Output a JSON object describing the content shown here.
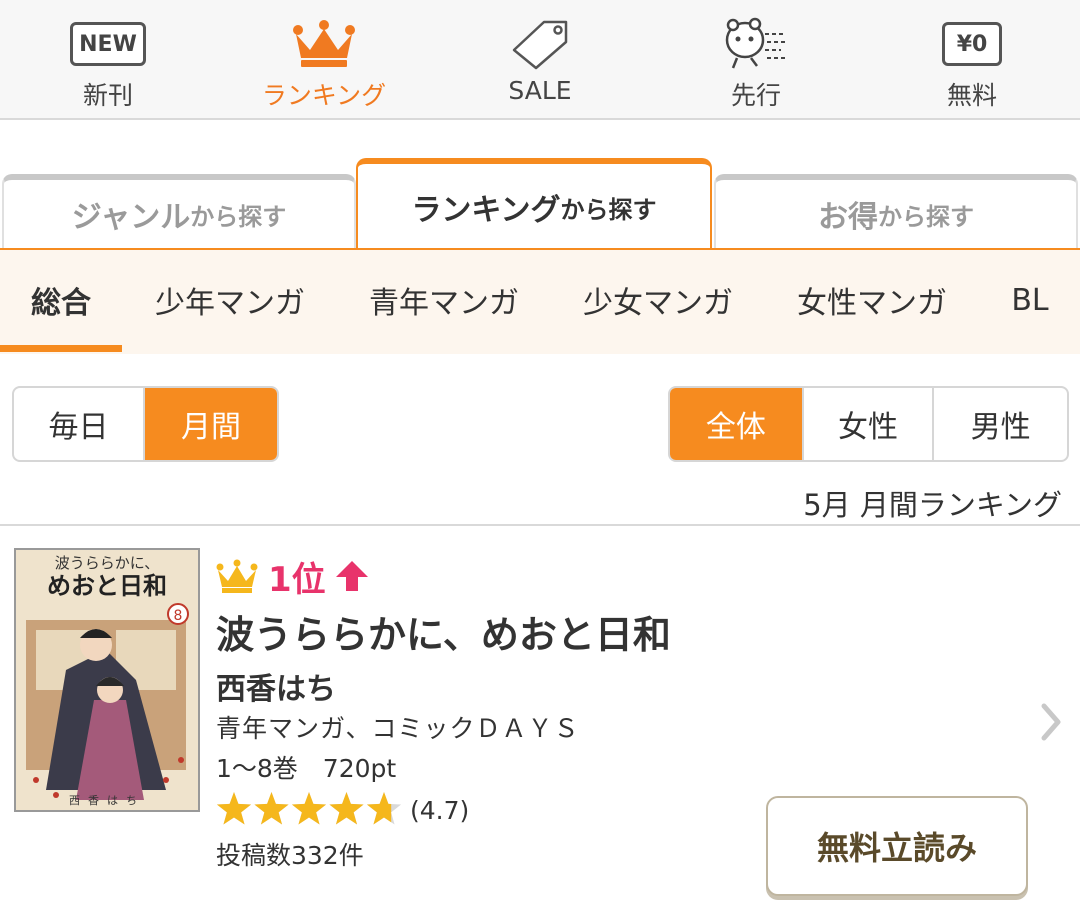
{
  "top_nav": {
    "items": [
      {
        "label": "新刊",
        "icon": "new-badge-icon",
        "badge": "NEW",
        "active": false
      },
      {
        "label": "ランキング",
        "icon": "crown-icon",
        "active": true
      },
      {
        "label": "SALE",
        "icon": "price-tag-icon",
        "active": false
      },
      {
        "label": "先行",
        "icon": "running-mascot-icon",
        "active": false
      },
      {
        "label": "無料",
        "icon": "yen-zero-badge-icon",
        "badge": "¥0",
        "active": false
      }
    ]
  },
  "category_tabs": [
    {
      "main": "ジャンル",
      "suffix": "から探す",
      "active": false
    },
    {
      "main": "ランキング",
      "suffix": "から探す",
      "active": true
    },
    {
      "main": "お得",
      "suffix": "から探す",
      "active": false
    }
  ],
  "genre_tabs": [
    {
      "label": "総合",
      "active": true
    },
    {
      "label": "少年マンガ",
      "active": false
    },
    {
      "label": "青年マンガ",
      "active": false
    },
    {
      "label": "少女マンガ",
      "active": false
    },
    {
      "label": "女性マンガ",
      "active": false
    },
    {
      "label": "BL",
      "active": false
    }
  ],
  "period_toggle": [
    {
      "label": "毎日",
      "selected": false
    },
    {
      "label": "月間",
      "selected": true
    }
  ],
  "audience_toggle": [
    {
      "label": "全体",
      "selected": true
    },
    {
      "label": "女性",
      "selected": false
    },
    {
      "label": "男性",
      "selected": false
    }
  ],
  "period_title": "5月 月間ランキング",
  "ranking_item": {
    "rank": "1位",
    "trend": "up",
    "title": "波うららかに、めおと日和",
    "author": "西香はち",
    "genre_publisher": "青年マンガ、コミックＤＡＹＳ",
    "volumes_price": "1〜8巻　720pt",
    "rating": 4.7,
    "rating_text": "(4.7)",
    "posts": "投稿数332件",
    "free_read_label": "無料立読み",
    "cover": {
      "title_top": "波うららかに、",
      "title_main": "めおと日和",
      "volume": "8",
      "author": "西香はち"
    }
  },
  "colors": {
    "accent_orange": "#f68b1f",
    "rank_pink": "#e8336b",
    "star_gold": "#f5b71c"
  }
}
